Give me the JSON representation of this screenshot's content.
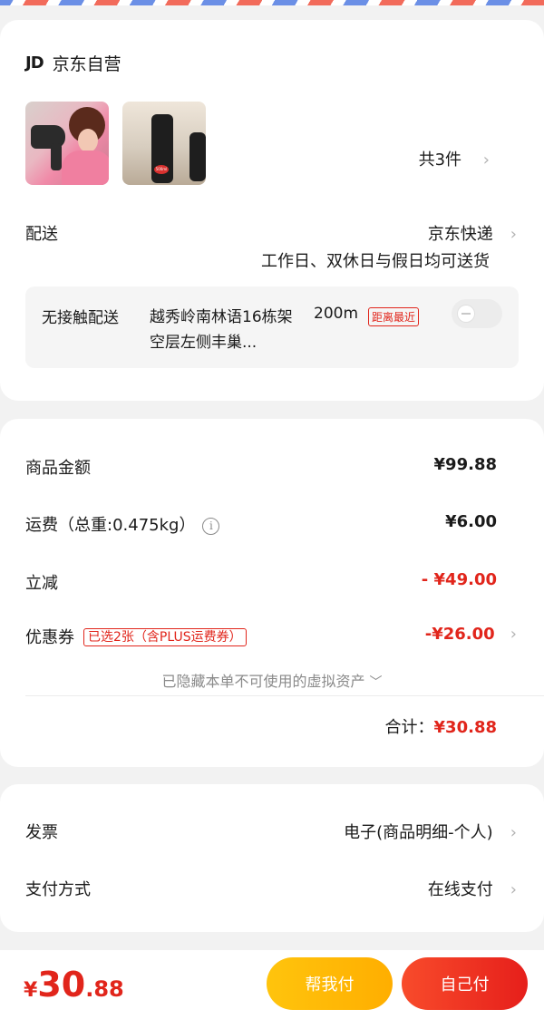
{
  "shop": {
    "logo": "JD",
    "name": "京东自营"
  },
  "products": {
    "count_label": "共3件",
    "thumb2_tag": "500ml"
  },
  "delivery": {
    "label": "配送",
    "carrier": "京东快递",
    "note": "工作日、双休日与假日均可送货"
  },
  "no_contact": {
    "label": "无接触配送",
    "address": "越秀岭南林语16栋架空层左侧丰巢...",
    "distance": "200m",
    "badge": "距离最近",
    "toggle_on": false
  },
  "pricing": {
    "goods_label": "商品金额",
    "goods_value": "¥99.88",
    "shipping_label": "运费（总重:0.475kg）",
    "shipping_value": "¥6.00",
    "discount_label": "立减",
    "discount_value": "- ¥49.00",
    "coupon_label": "优惠券",
    "coupon_badge": "已选2张（含PLUS运费券）",
    "coupon_value": "-¥26.00",
    "hidden_assets": "已隐藏本单不可使用的虚拟资产",
    "total_label": "合计：",
    "total_value": "¥30.88"
  },
  "invoice": {
    "label": "发票",
    "value": "电子(商品明细-个人)"
  },
  "payment": {
    "label": "支付方式",
    "value": "在线支付"
  },
  "bottom": {
    "currency": "¥",
    "price_int": "30",
    "price_dec": ".88",
    "help_pay": "帮我付",
    "self_pay": "自己付"
  },
  "colors": {
    "accent_red": "#e1251b",
    "help_btn": "#ffb800",
    "self_btn": "#f23a22"
  }
}
